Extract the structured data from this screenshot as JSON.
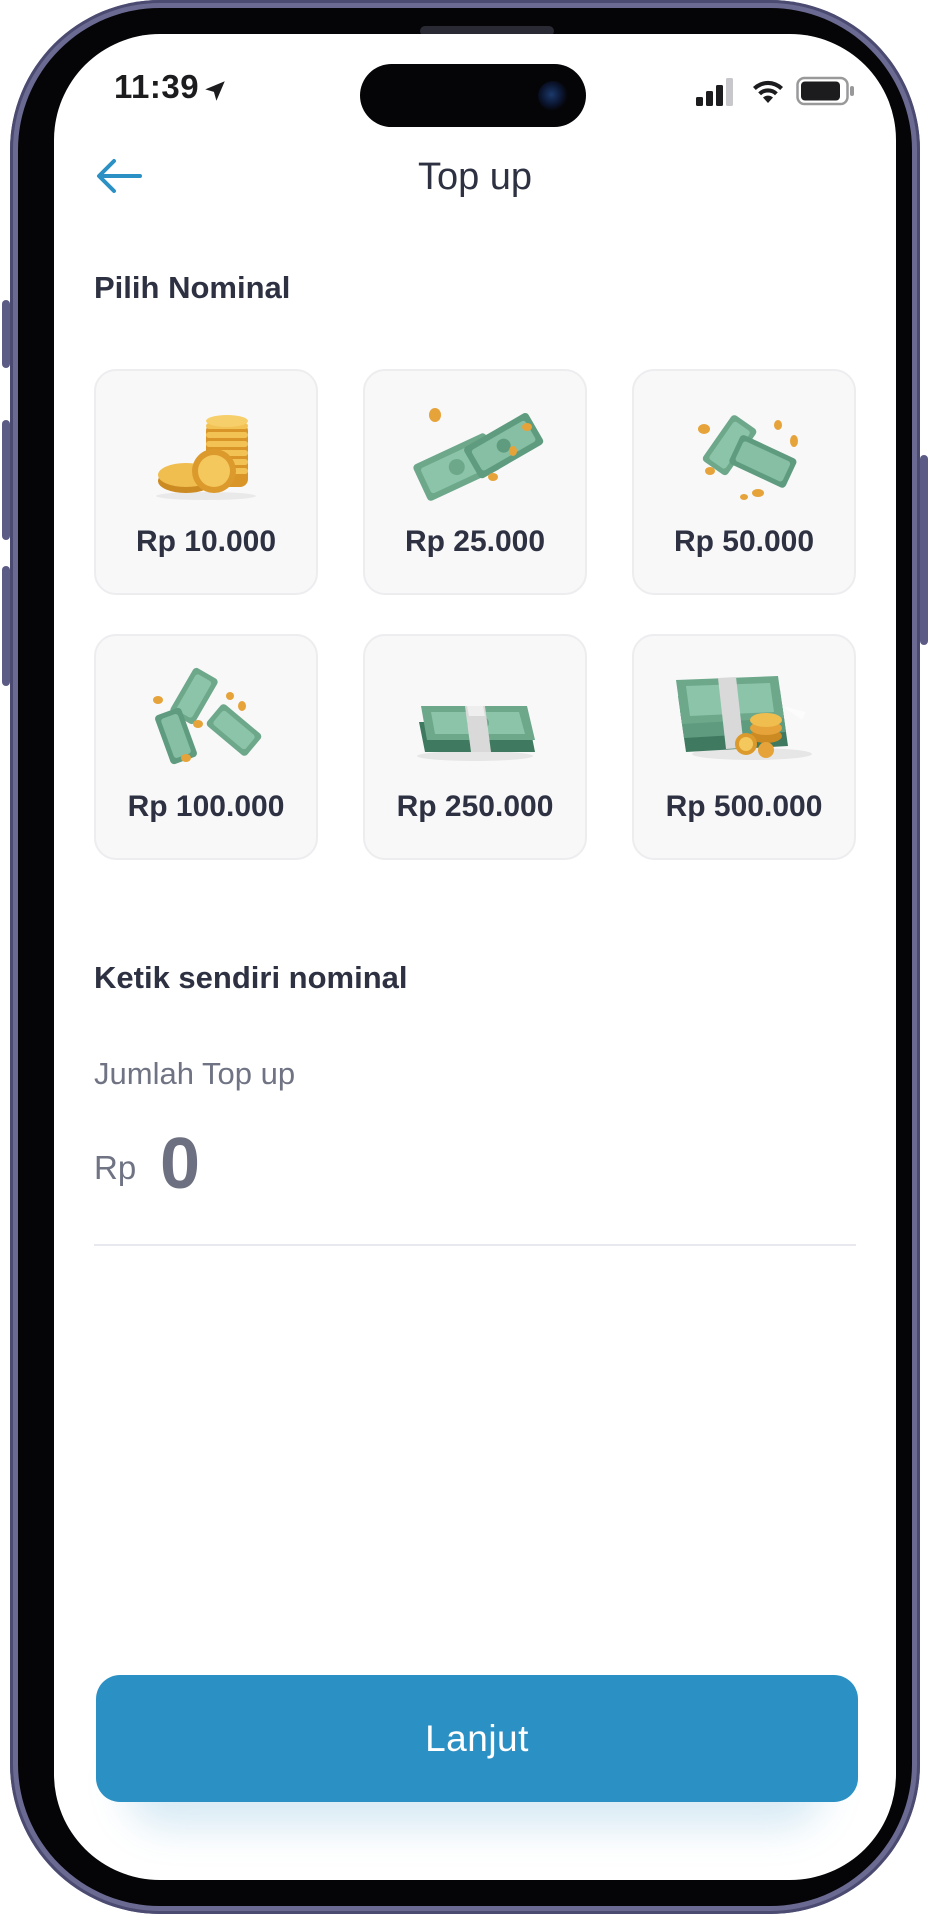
{
  "status_bar": {
    "time": "11:39"
  },
  "header": {
    "title": "Top up"
  },
  "preset_section": {
    "title": "Pilih Nominal",
    "options": [
      {
        "label": "Rp 10.000",
        "icon": "coin-stack-icon"
      },
      {
        "label": "Rp 25.000",
        "icon": "cash-notes-icon"
      },
      {
        "label": "Rp 50.000",
        "icon": "flying-cash-icon"
      },
      {
        "label": "Rp 100.000",
        "icon": "scattered-cash-icon"
      },
      {
        "label": "Rp 250.000",
        "icon": "cash-bundle-icon"
      },
      {
        "label": "Rp 500.000",
        "icon": "cash-stack-coins-icon"
      }
    ]
  },
  "custom_section": {
    "title": "Ketik sendiri nominal",
    "input_label": "Jumlah Top up",
    "currency": "Rp",
    "value": "0"
  },
  "continue_button": {
    "label": "Lanjut"
  },
  "colors": {
    "accent": "#2b91c5",
    "text_primary": "#2d3142",
    "text_muted": "#6f7383",
    "card_bg": "#f8f8f9",
    "cash_green": "#7fb79c",
    "coin_gold": "#e8a93a"
  }
}
